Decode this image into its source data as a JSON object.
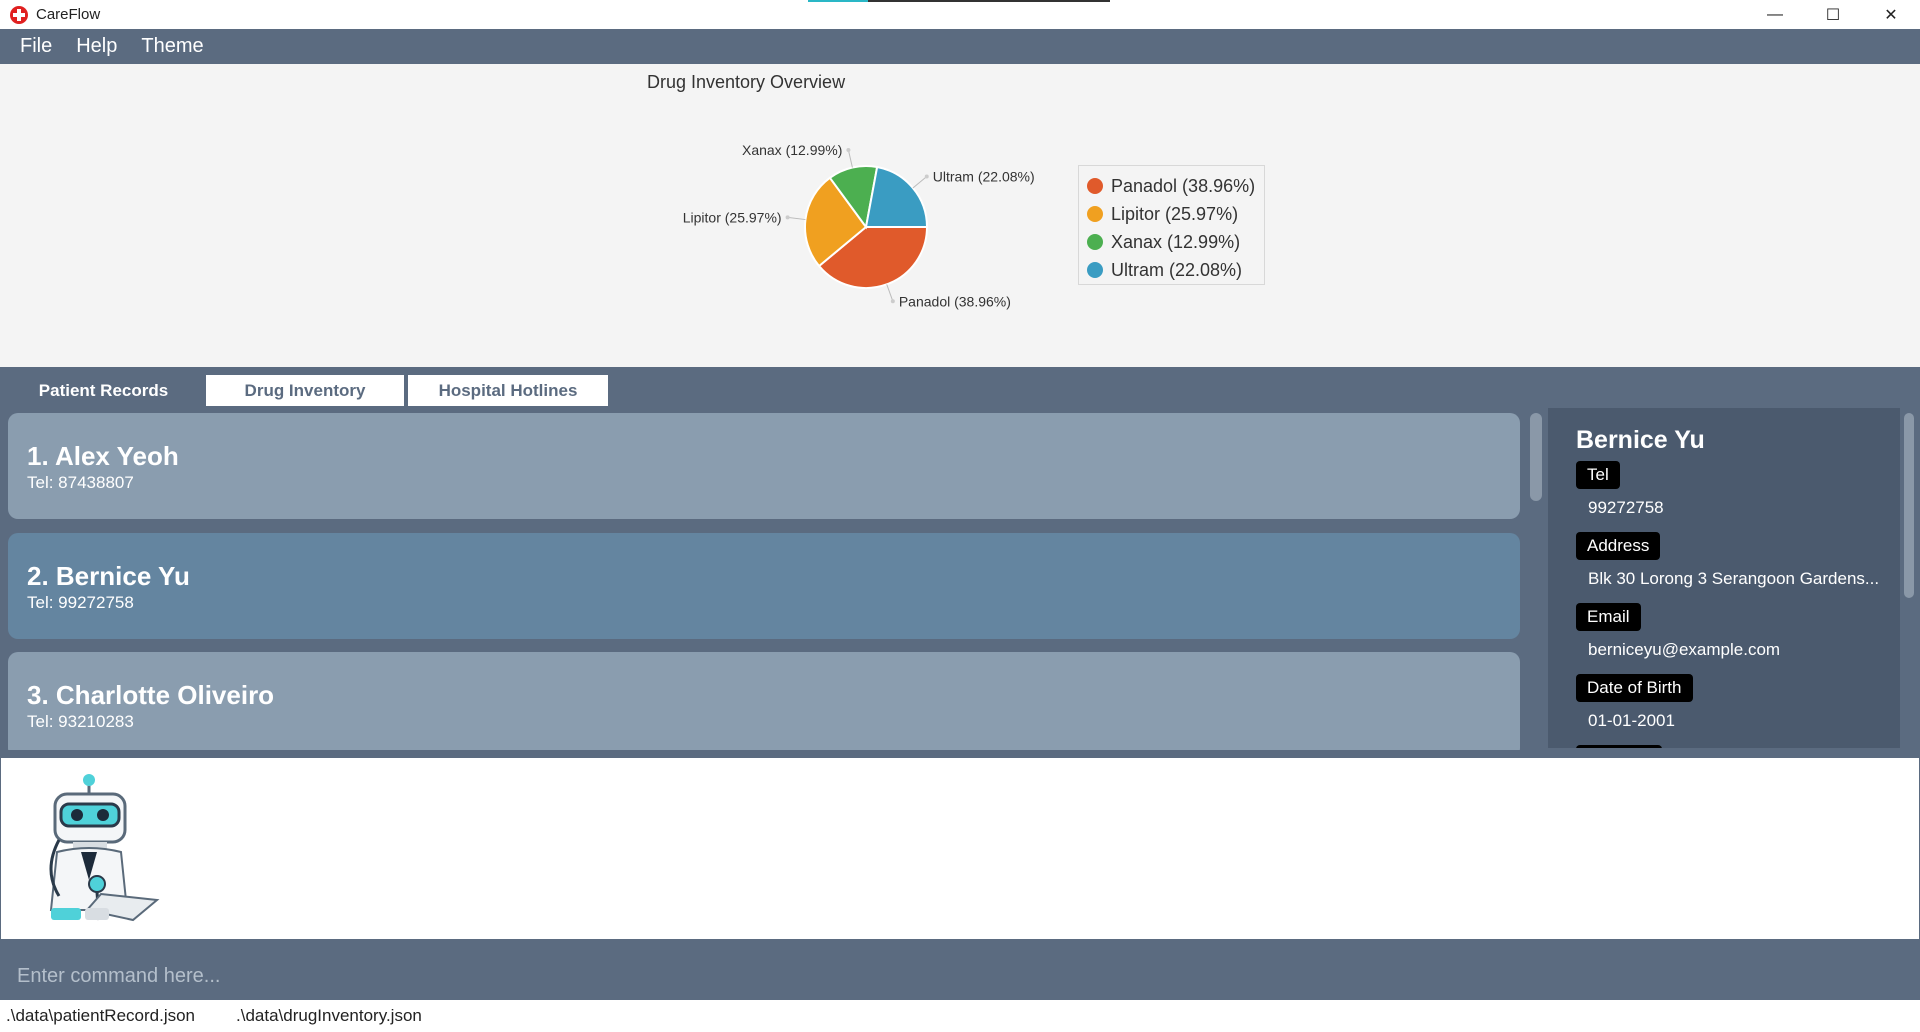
{
  "window": {
    "title": "CareFlow",
    "progress": 0.2,
    "controls": {
      "minimize": "—",
      "maximize": "☐",
      "close": "✕"
    }
  },
  "menu": {
    "items": [
      "File",
      "Help",
      "Theme"
    ]
  },
  "chart_data": {
    "type": "pie",
    "title": "Drug Inventory Overview",
    "slices": [
      {
        "label": "Panadol (38.96%)",
        "value": 38.96,
        "color": "#e05a2b"
      },
      {
        "label": "Lipitor (25.97%)",
        "value": 25.97,
        "color": "#f0a020"
      },
      {
        "label": "Xanax (12.99%)",
        "value": 12.99,
        "color": "#4caf50"
      },
      {
        "label": "Ultram (22.08%)",
        "value": 22.08,
        "color": "#3a9cc2"
      }
    ],
    "legend": "right"
  },
  "tabs": [
    {
      "label": "Patient Records",
      "active": true
    },
    {
      "label": "Drug Inventory",
      "active": false
    },
    {
      "label": "Hospital Hotlines",
      "active": false
    }
  ],
  "patients": [
    {
      "name": "1.  Alex Yeoh",
      "tel": "Tel: 87438807",
      "color": "#8a9daf"
    },
    {
      "name": "2.  Bernice Yu",
      "tel": "Tel: 99272758",
      "color": "#6485a0"
    },
    {
      "name": "3.  Charlotte Oliveiro",
      "tel": "Tel: 93210283",
      "color": "#8a9daf"
    }
  ],
  "detail": {
    "name": "Bernice Yu",
    "fields": [
      {
        "label": "Tel",
        "value": "99272758"
      },
      {
        "label": "Address",
        "value": "Blk 30 Lorong 3 Serangoon Gardens..."
      },
      {
        "label": "Email",
        "value": "berniceyu@example.com"
      },
      {
        "label": "Date of Birth",
        "value": "01-01-2001"
      }
    ]
  },
  "command": {
    "placeholder": "Enter command here..."
  },
  "status": {
    "patient_file": ".\\data\\patientRecord.json",
    "drug_file": ".\\data\\drugInventory.json"
  }
}
